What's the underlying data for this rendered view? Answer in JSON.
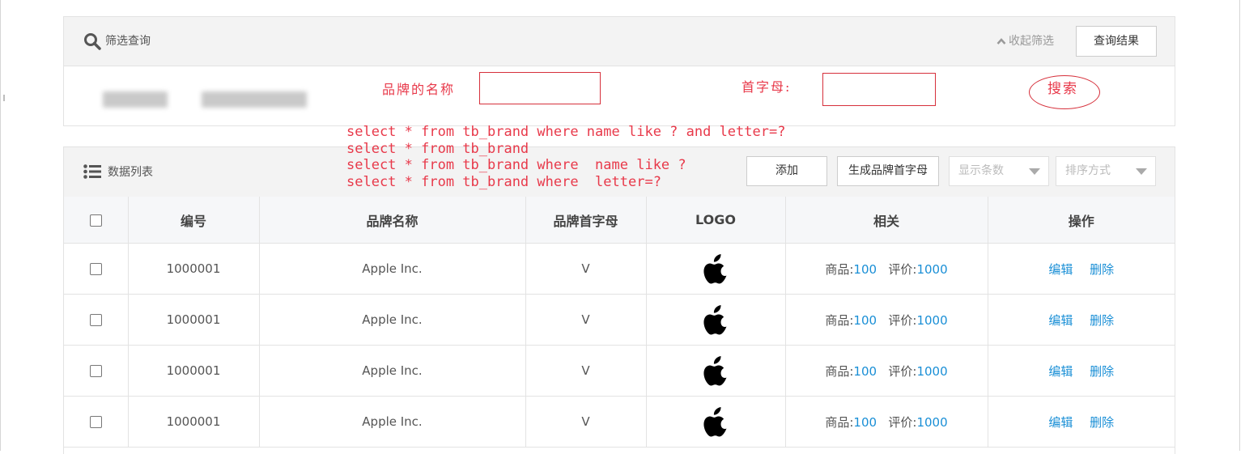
{
  "filter": {
    "title": "筛选查询",
    "collapse_label": "收起筛选",
    "query_button": "查询结果"
  },
  "annotations": {
    "brand_name_label": "品牌的名称",
    "letter_label": "首字母:",
    "search_label": "搜索",
    "sql_lines": [
      "select * from tb_brand where name like ? and letter=?",
      "select * from tb_brand",
      "select * from tb_brand where  name like ?",
      "select * from tb_brand where  letter=?"
    ]
  },
  "list": {
    "title": "数据列表",
    "add_button": "添加",
    "generate_button": "生成品牌首字母",
    "page_size_placeholder": "显示条数",
    "sort_placeholder": "排序方式",
    "columns": [
      "编号",
      "品牌名称",
      "品牌首字母",
      "LOGO",
      "相关",
      "操作"
    ],
    "rows": [
      {
        "id": "1000001",
        "name": "Apple Inc.",
        "letter": "V",
        "goods_label": "商品:",
        "goods_count": "100",
        "review_label": "评价:",
        "review_count": "1000",
        "edit": "编辑",
        "delete": "删除"
      },
      {
        "id": "1000001",
        "name": "Apple Inc.",
        "letter": "V",
        "goods_label": "商品:",
        "goods_count": "100",
        "review_label": "评价:",
        "review_count": "1000",
        "edit": "编辑",
        "delete": "删除"
      },
      {
        "id": "1000001",
        "name": "Apple Inc.",
        "letter": "V",
        "goods_label": "商品:",
        "goods_count": "100",
        "review_label": "评价:",
        "review_count": "1000",
        "edit": "编辑",
        "delete": "删除"
      },
      {
        "id": "1000001",
        "name": "Apple Inc.",
        "letter": "V",
        "goods_label": "商品:",
        "goods_count": "100",
        "review_label": "评价:",
        "review_count": "1000",
        "edit": "编辑",
        "delete": "删除"
      }
    ]
  },
  "colors": {
    "annotation_red": "#e8394a",
    "link_blue": "#1a8fd6"
  },
  "icons": {
    "filter_icon": "search-icon",
    "list_icon": "list-icon",
    "collapse_icon": "chevron-up-icon",
    "logo_icon": "apple-logo-icon"
  }
}
